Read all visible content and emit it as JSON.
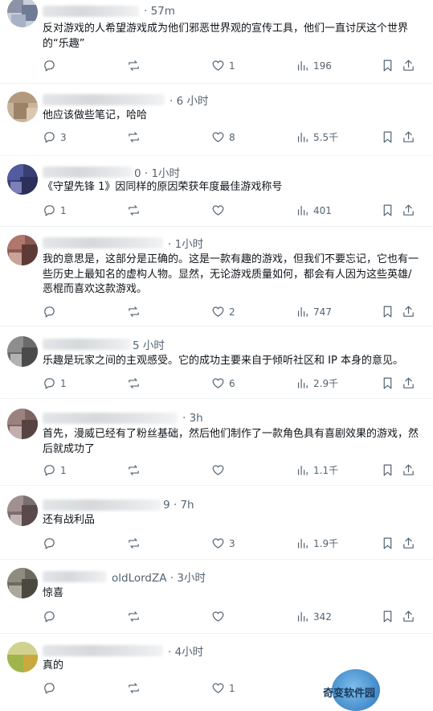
{
  "tweets": [
    {
      "time": "· 57m",
      "text": "反对游戏的人希望游戏成为他们邪恶世界观的宣传工具，他们一直讨厌这个世界的“乐趣”",
      "replies": "",
      "reposts": "",
      "likes": "1",
      "views": "196"
    },
    {
      "time": "· 6 小时",
      "text": "他应该做些笔记，哈哈",
      "replies": "3",
      "reposts": "",
      "likes": "8",
      "views": "5.5千"
    },
    {
      "time": "0 · 1小时",
      "text": "《守望先锋 1》因同样的原因荣获年度最佳游戏称号",
      "replies": "1",
      "reposts": "",
      "likes": "",
      "views": "401"
    },
    {
      "time": "· 1小时",
      "text": "我的意思是，这部分是正确的。这是一款有趣的游戏，但我们不要忘记，它也有一些历史上最知名的虚构人物。显然，无论游戏质量如何，都会有人因为这些英雄/恶棍而喜欢这款游戏。",
      "replies": "",
      "reposts": "",
      "likes": "2",
      "views": "747"
    },
    {
      "time": "5 小时",
      "text": "乐趣是玩家之间的主观感受。它的成功主要来自于倾听社区和 IP 本身的意见。",
      "replies": "1",
      "reposts": "",
      "likes": "6",
      "views": "2.9千"
    },
    {
      "time": "· 3h",
      "text": "首先，漫威已经有了粉丝基础，然后他们制作了一款角色具有喜剧效果的游戏，然后就成功了",
      "replies": "1",
      "reposts": "",
      "likes": "",
      "views": "1.1千"
    },
    {
      "time": "9 · 7h",
      "text": "还有战利品",
      "replies": "",
      "reposts": "",
      "likes": "3",
      "views": "1.9千"
    },
    {
      "time": "oldLordZA · 3小时",
      "text": "惊喜",
      "replies": "",
      "reposts": "",
      "likes": "",
      "views": "342"
    },
    {
      "time": "· 4小时",
      "text": "真的",
      "replies": "",
      "reposts": "",
      "likes": "1",
      "views": ""
    }
  ],
  "watermark": {
    "text": "奇变软件园"
  },
  "icons": {
    "reply": "reply-icon",
    "repost": "repost-icon",
    "like": "heart-icon",
    "views": "views-icon",
    "bookmark": "bookmark-icon",
    "share": "share-icon"
  },
  "colors": {
    "text": "#0f1419",
    "secondary": "#536471",
    "divider": "#eff3f4"
  }
}
